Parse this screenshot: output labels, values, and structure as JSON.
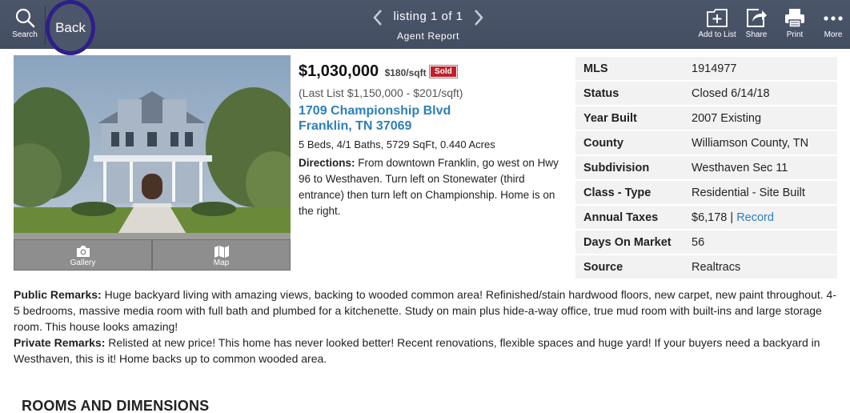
{
  "topbar": {
    "search_label": "Search",
    "back_label": "Back",
    "nav_title": "listing 1 of 1",
    "nav_subtitle": "Agent Report",
    "add_to_list_label": "Add to List",
    "share_label": "Share",
    "print_label": "Print",
    "more_label": "More"
  },
  "photo_nav": {
    "gallery_label": "Gallery",
    "map_label": "Map"
  },
  "summary": {
    "price": "$1,030,000",
    "price_per_sqft": "$180/sqft",
    "status_badge": "Sold",
    "last_list": "(Last List $1,150,000 - $201/sqft)",
    "address_line1": "1709 Championship Blvd",
    "address_line2": "Franklin, TN 37069",
    "facts": "5 Beds, 4/1 Baths, 5729 SqFt, 0.440 Acres",
    "directions_label": "Directions:",
    "directions_text": " From downtown Franklin, go west on Hwy 96 to Westhaven. Turn left on Stonewater (third entrance) then turn left on Championship. Home is on the right."
  },
  "details": [
    {
      "label": "MLS",
      "value": "1914977"
    },
    {
      "label": "Status",
      "value": "Closed 6/14/18"
    },
    {
      "label": "Year Built",
      "value": "2007 Existing"
    },
    {
      "label": "County",
      "value": "Williamson County, TN"
    },
    {
      "label": "Subdivision",
      "value": "Westhaven Sec 11"
    },
    {
      "label": "Class - Type",
      "value": "Residential - Site Built"
    },
    {
      "label": "Annual Taxes",
      "value": "$6,178 | ",
      "link": "Record"
    },
    {
      "label": "Days On Market",
      "value": "56"
    },
    {
      "label": "Source",
      "value": "Realtracs"
    }
  ],
  "remarks": {
    "public_label": "Public Remarks:",
    "public_text": " Huge backyard living with amazing views, backing to wooded common area! Refinished/stain hardwood floors, new carpet, new paint throughout. 4-5 bedrooms, massive media room with full bath and plumbed for a kitchenette. Study on main plus hide-a-way office, true mud room with built-ins and large storage room. This house looks amazing!",
    "private_label": "Private Remarks:",
    "private_text": " Relisted at new price! This home has never looked better! Recent renovations, flexible spaces and huge yard! If your buyers need a backyard in Westhaven, this is it! Home backs up to common wooded area."
  },
  "rooms_title": "ROOMS AND DIMENSIONS"
}
